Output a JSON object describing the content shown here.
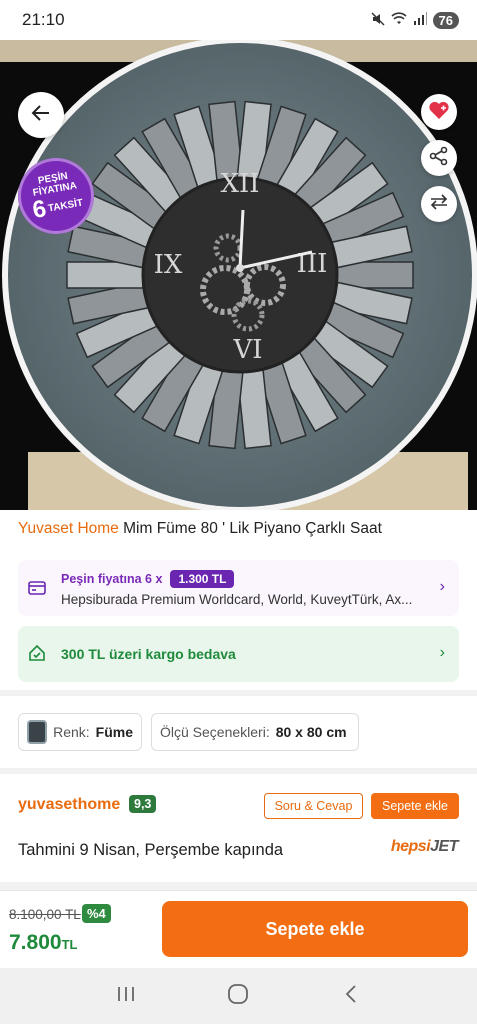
{
  "status_bar": {
    "time": "21:10",
    "battery": "76"
  },
  "hero": {
    "badge_line1": "PEŞİN",
    "badge_line2": "FİYATINA",
    "badge_number": "6",
    "badge_word": "TAKSİT"
  },
  "product": {
    "brand": "Yuvaset Home",
    "name": " Mim Füme  80 ' Lik Piyano Çarklı Saat"
  },
  "installment": {
    "label": "Peşin fiyatına 6 x",
    "amount": "1.300 TL",
    "banks": "Hepsiburada Premium Worldcard, World, KuveytTürk, Ax..."
  },
  "cargo": {
    "text": "300 TL üzeri kargo bedava"
  },
  "options": {
    "color_label": "Renk:",
    "color_value": "Füme",
    "size_label": "Ölçü Seçenekleri:",
    "size_value": "80 x 80 cm"
  },
  "seller": {
    "name": "yuvasethome",
    "rating": "9,3",
    "qa_label": "Soru & Cevap",
    "add_to_cart_label": "Sepete ekle",
    "delivery": "Tahmini 9 Nisan, Perşembe kapında",
    "carrier_part1": "hepsi",
    "carrier_part2": "JET"
  },
  "price": {
    "old": "8.100,00 TL",
    "discount": "%4",
    "current": "7.800",
    "currency": "TL",
    "button_label": "Sepete ekle"
  },
  "icons": {
    "back": "arrow-left-icon",
    "favorite": "heart-icon",
    "share": "share-icon",
    "compare": "compare-arrows-icon",
    "card": "credit-card-icon",
    "cargo": "home-delivery-icon",
    "nav_recent": "recent-apps-icon",
    "nav_home": "home-circle-icon",
    "nav_back": "back-chevron-icon"
  },
  "colors": {
    "brand_orange": "#f36e12",
    "installment_purple": "#6a26b1",
    "success_green": "#1f8a3b"
  }
}
